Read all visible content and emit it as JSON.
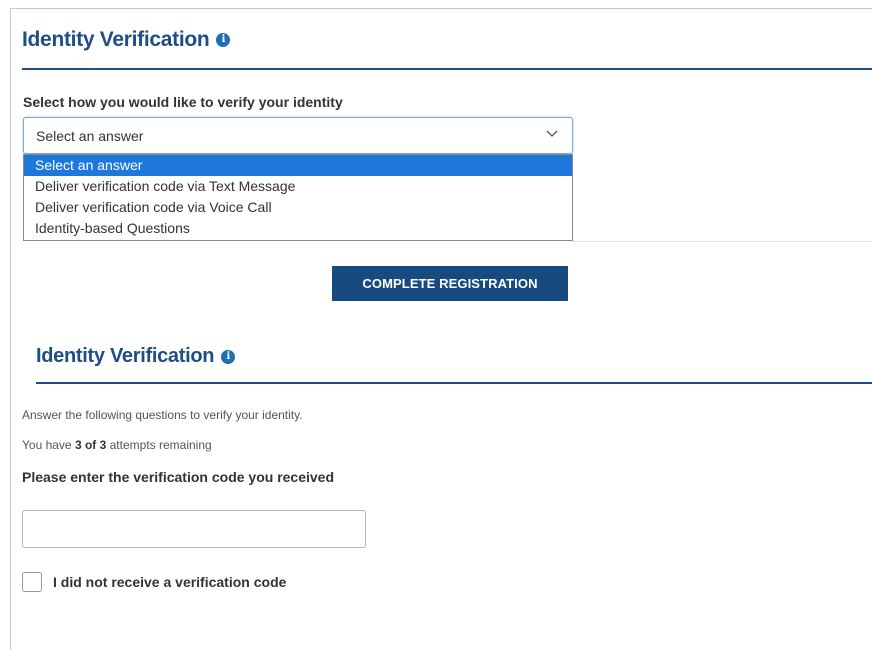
{
  "section1": {
    "title": "Identity Verification",
    "select_label": "Select how you would like to verify your identity",
    "select_value": "Select an answer",
    "options": [
      "Select an answer",
      "Deliver verification code via Text Message",
      "Deliver verification code via Voice Call",
      "Identity-based Questions"
    ],
    "selected_index": 0
  },
  "complete_button": "COMPLETE REGISTRATION",
  "section2": {
    "title": "Identity Verification",
    "instruction": "Answer the following questions to verify your identity.",
    "attempts_prefix": "You have ",
    "attempts_value": "3 of 3",
    "attempts_suffix": " attempts remaining",
    "code_label": "Please enter the verification code you received",
    "code_value": "",
    "checkbox_label": "I did not receive a verification code",
    "checkbox_checked": false
  },
  "icons": {
    "info": "info-icon",
    "dropdown": "chevron-down-icon"
  },
  "colors": {
    "heading": "#1f4e86",
    "button_bg": "#174a7e",
    "highlight": "#1e78dc"
  }
}
